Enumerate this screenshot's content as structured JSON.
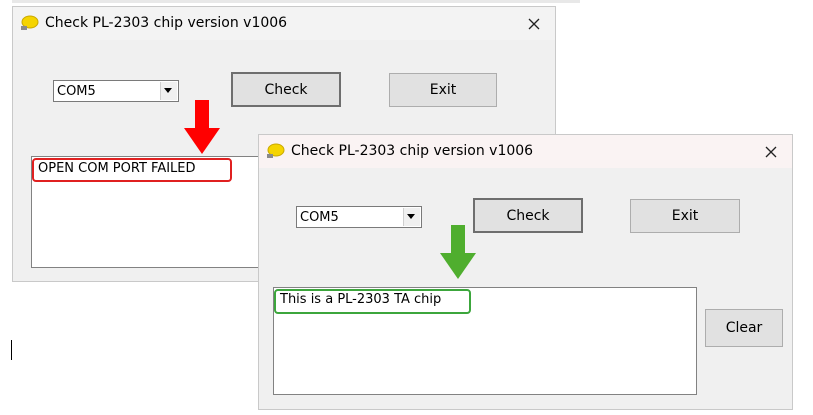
{
  "window_back": {
    "title": "Check PL-2303 chip version v1006",
    "combo_value": "COM5",
    "check_label": "Check",
    "exit_label": "Exit",
    "message": "OPEN COM PORT FAILED"
  },
  "window_front": {
    "title": "Check PL-2303 chip version v1006",
    "combo_value": "COM5",
    "check_label": "Check",
    "exit_label": "Exit",
    "clear_label": "Clear",
    "message": "This is a PL-2303 TA chip"
  },
  "colors": {
    "fail_highlight": "#e02020",
    "success_highlight": "#3ca63c",
    "fail_arrow": "#ff0000",
    "success_arrow": "#4fae2e"
  }
}
